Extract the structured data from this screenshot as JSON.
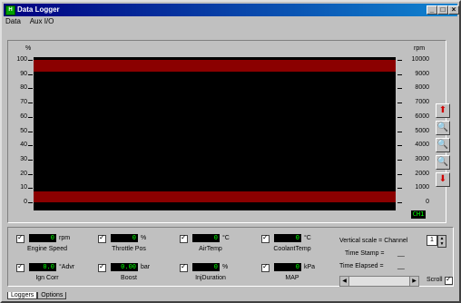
{
  "window": {
    "title": "Data Logger"
  },
  "menu": [
    {
      "label": "Data"
    },
    {
      "label": "Aux I/O"
    }
  ],
  "left_axis": {
    "unit": "%",
    "ticks": [
      "100",
      "90",
      "80",
      "70",
      "60",
      "50",
      "40",
      "30",
      "20",
      "10",
      "0"
    ]
  },
  "right_axis": {
    "unit": "rpm",
    "ticks": [
      "10000",
      "9000",
      "8000",
      "7000",
      "6000",
      "5000",
      "4000",
      "3000",
      "2000",
      "1000",
      "0"
    ]
  },
  "right_readout": "CH1",
  "right_buttons": [
    {
      "icon": "red-arrow-up-icon",
      "glyph": "⬆"
    },
    {
      "icon": "zoom-in-icon",
      "glyph": "🔍"
    },
    {
      "icon": "zoom-all-icon",
      "glyph": "🔍"
    },
    {
      "icon": "zoom-out-icon",
      "glyph": "🔍"
    },
    {
      "icon": "red-arrow-down-icon",
      "glyph": "⬇"
    }
  ],
  "channels": [
    {
      "label": "Engine Speed",
      "unit": "rpm",
      "value": "0"
    },
    {
      "label": "Throttle Pos",
      "unit": "%",
      "value": "0"
    },
    {
      "label": "AirTemp",
      "unit": "°C",
      "value": "0"
    },
    {
      "label": "CoolantTemp",
      "unit": "°C",
      "value": "0"
    },
    {
      "label": "Ign Corr",
      "unit": "°Advr",
      "value": "0.0"
    },
    {
      "label": "Boost",
      "unit": "bar",
      "value": "0.00"
    },
    {
      "label": "InjDuration",
      "unit": "%",
      "value": "0"
    },
    {
      "label": "MAP",
      "unit": "kPa",
      "value": "0"
    }
  ],
  "vertical_scale": {
    "label": "Vertical scale = Channel",
    "value": "1"
  },
  "time_stamp": {
    "label": "Time Stamp =",
    "value": "__"
  },
  "time_elapsed": {
    "label": "Time Elapsed =",
    "value": "__"
  },
  "scroll": {
    "label": "Scroll"
  },
  "tabs": [
    {
      "label": "Loggers"
    },
    {
      "label": "Options"
    }
  ],
  "colors": {
    "band": "#8b0000",
    "lcd_text": "#00ff00",
    "title_bar": "#000080"
  }
}
